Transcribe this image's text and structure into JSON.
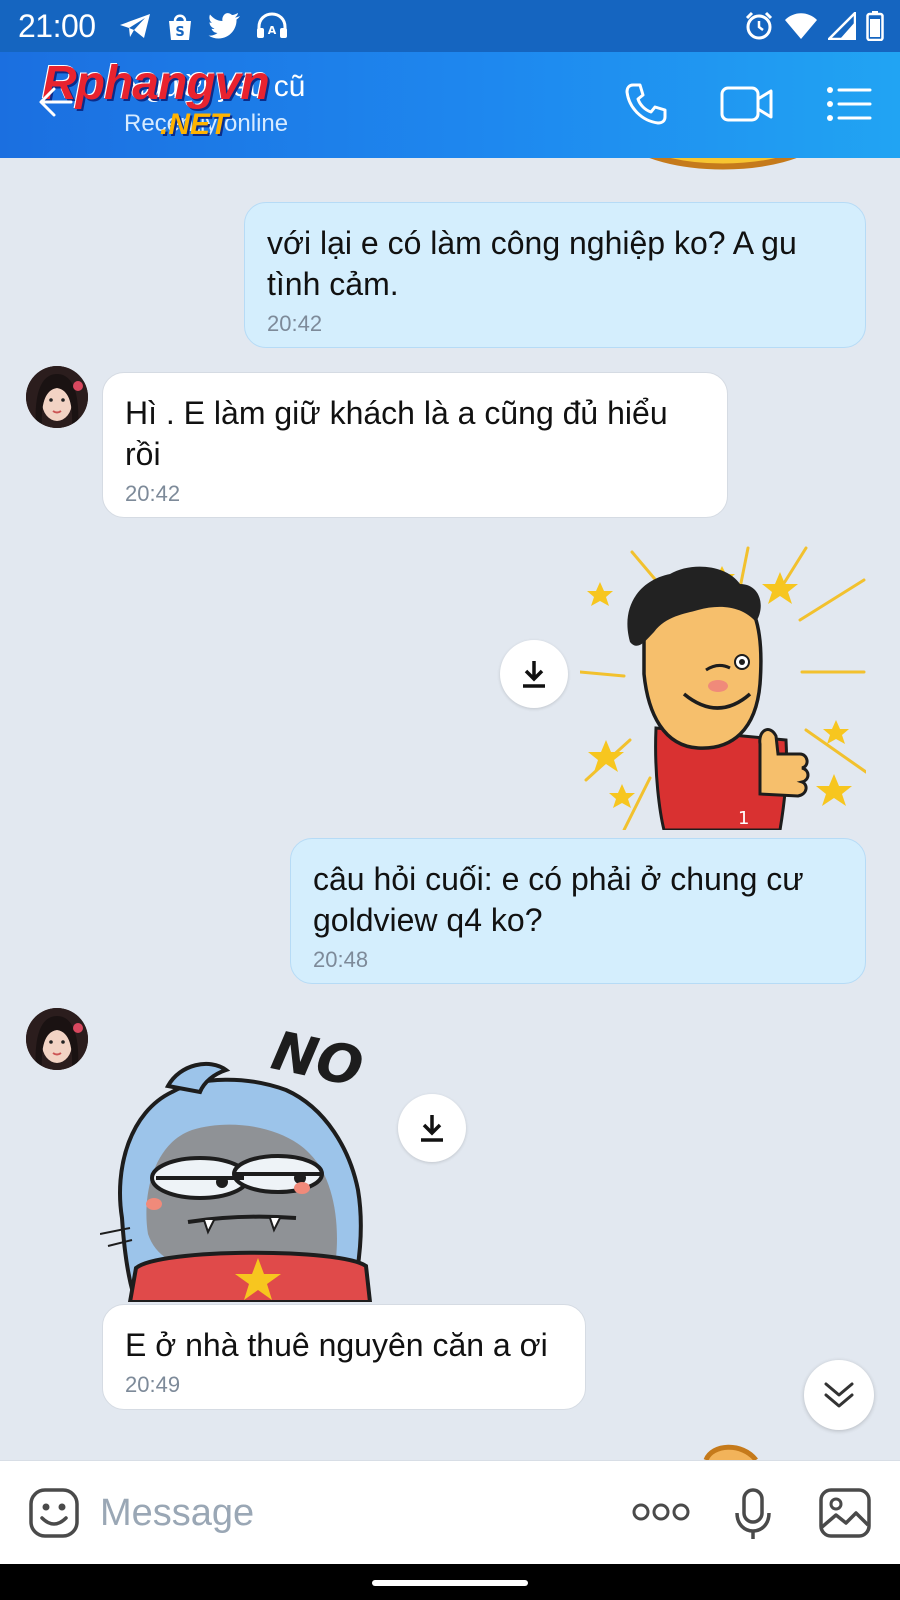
{
  "status_bar": {
    "time": "21:00",
    "left_icons": [
      "telegram-icon",
      "shopee-icon",
      "twitter-icon",
      "headset-icon"
    ],
    "right_icons": [
      "alarm-icon",
      "wifi-icon",
      "signal-icon",
      "battery-icon"
    ]
  },
  "header": {
    "title": "Người yêu cũ",
    "subtitle": "Recently online",
    "watermark_top": "Rphangvn",
    "watermark_bottom": ".NET",
    "actions": [
      "phone-icon",
      "video-icon",
      "menu-icon"
    ]
  },
  "messages": [
    {
      "direction": "out",
      "type": "text",
      "text": "với lại e có làm công nghiệp ko? A gu tình cảm.",
      "time": "20:42"
    },
    {
      "direction": "in",
      "type": "text",
      "text": "Hì . E làm giữ khách là a cũng đủ hiểu rồi",
      "time": "20:42"
    },
    {
      "direction": "out",
      "type": "sticker",
      "sticker": "thumbs-up-wink-sticker"
    },
    {
      "direction": "out",
      "type": "text",
      "text": "câu hỏi cuối: e có phải ở chung cư goldview q4 ko?",
      "time": "20:48"
    },
    {
      "direction": "in",
      "type": "sticker",
      "sticker": "no-sticker",
      "sticker_text": "NO"
    },
    {
      "direction": "in",
      "type": "text",
      "text": "E ở nhà thuê nguyên căn a ơi",
      "time": "20:49"
    }
  ],
  "composer": {
    "placeholder": "Message",
    "icons": [
      "emoji-icon",
      "more-icon",
      "microphone-icon",
      "image-icon"
    ]
  },
  "colors": {
    "header_start": "#1b6fe0",
    "header_end": "#21a4f3",
    "status_bar": "#1565c0",
    "outgoing_bubble": "#d4eefd",
    "incoming_bubble": "#ffffff",
    "chat_background": "#e2e8f0"
  }
}
